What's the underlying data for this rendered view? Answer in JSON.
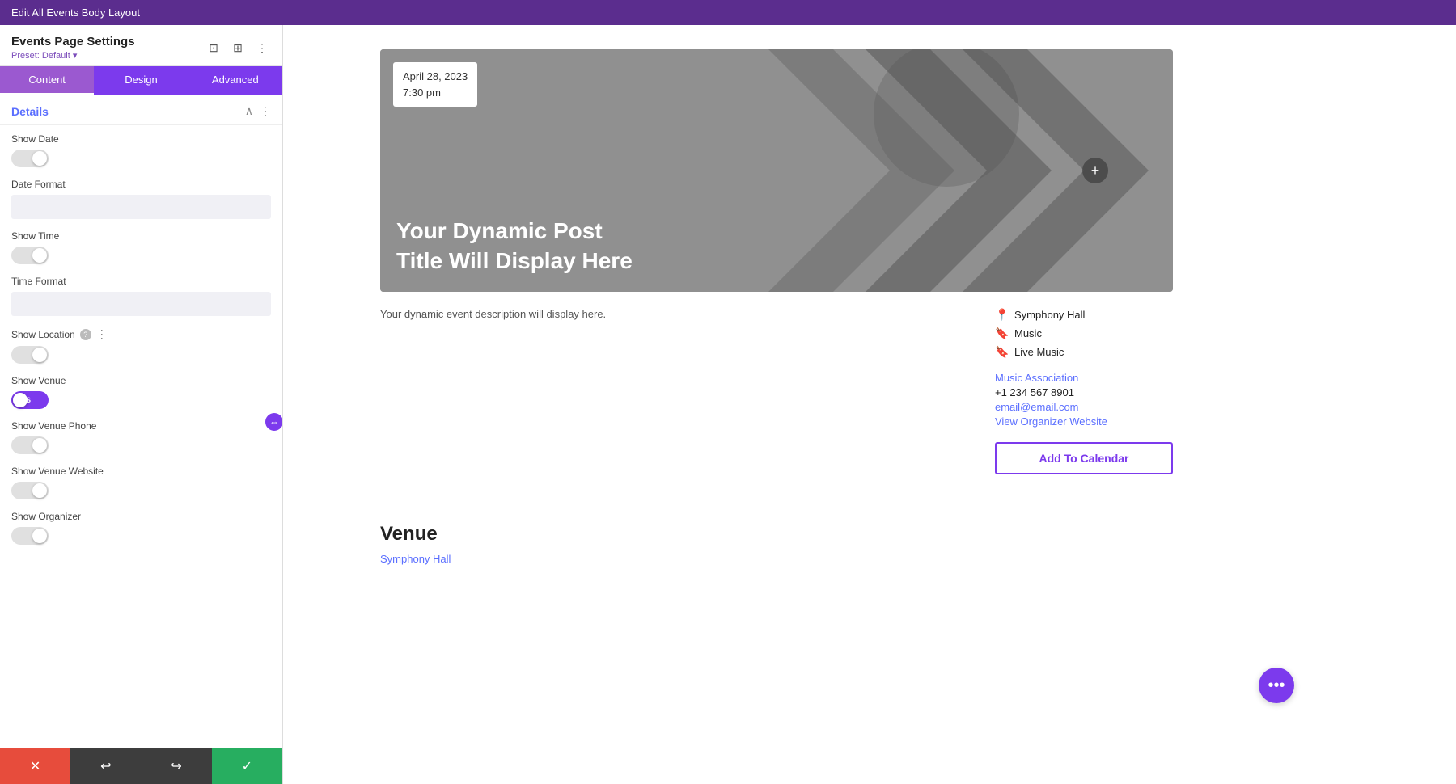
{
  "topBar": {
    "title": "Edit All Events Body Layout"
  },
  "leftPanel": {
    "title": "Events Page Settings",
    "preset": "Preset: Default",
    "tabs": [
      {
        "id": "content",
        "label": "Content",
        "active": true
      },
      {
        "id": "design",
        "label": "Design",
        "active": false
      },
      {
        "id": "advanced",
        "label": "Advanced",
        "active": false
      }
    ],
    "sections": {
      "details": {
        "title": "Details",
        "settings": [
          {
            "id": "show-date",
            "label": "Show Date",
            "type": "toggle",
            "value": "NO"
          },
          {
            "id": "date-format",
            "label": "Date Format",
            "type": "text",
            "value": ""
          },
          {
            "id": "show-time",
            "label": "Show Time",
            "type": "toggle",
            "value": "NO"
          },
          {
            "id": "time-format",
            "label": "Time Format",
            "type": "text",
            "value": ""
          },
          {
            "id": "show-location",
            "label": "Show Location",
            "type": "toggle",
            "value": "NO",
            "hasHelp": true
          },
          {
            "id": "show-venue",
            "label": "Show Venue",
            "type": "toggle",
            "value": "YES"
          },
          {
            "id": "show-venue-phone",
            "label": "Show Venue Phone",
            "type": "toggle",
            "value": "NO"
          },
          {
            "id": "show-venue-website",
            "label": "Show Venue Website",
            "type": "toggle",
            "value": "NO"
          },
          {
            "id": "show-organizer",
            "label": "Show Organizer",
            "type": "toggle",
            "value": "NO"
          }
        ]
      }
    }
  },
  "bottomToolbar": {
    "cancel": "✕",
    "undo": "↩",
    "redo": "↪",
    "save": "✓"
  },
  "mainContent": {
    "dateBadge": {
      "date": "April 28, 2023",
      "time": "7:30 pm"
    },
    "postTitle": "Your Dynamic Post Title Will Display Here",
    "description": "Your dynamic event description will display here.",
    "metaItems": [
      {
        "type": "location",
        "text": "Symphony Hall",
        "icon": "📍"
      },
      {
        "type": "category",
        "text": "Music",
        "icon": "🔖"
      },
      {
        "type": "category",
        "text": "Live Music",
        "icon": "🔖"
      }
    ],
    "organizer": {
      "name": "Music Association",
      "phone": "+1 234 567 8901",
      "email": "email@email.com",
      "website": "View Organizer Website"
    },
    "addToCalendar": "Add To Calendar",
    "venue": {
      "title": "Venue",
      "link": "Symphony Hall"
    }
  }
}
